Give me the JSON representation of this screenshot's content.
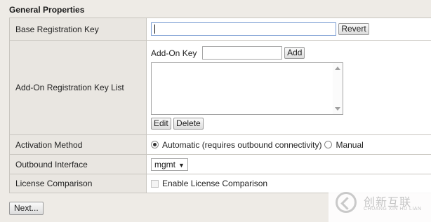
{
  "section": {
    "title": "General Properties"
  },
  "rows": {
    "base_key": {
      "label": "Base Registration Key",
      "value": "",
      "revert_label": "Revert"
    },
    "addon": {
      "label": "Add-On Registration Key List",
      "addon_key_label": "Add-On Key",
      "addon_key_value": "",
      "add_label": "Add",
      "edit_label": "Edit",
      "delete_label": "Delete"
    },
    "activation": {
      "label": "Activation Method",
      "automatic_label": "Automatic (requires outbound connectivity)",
      "manual_label": "Manual",
      "selected": "automatic"
    },
    "outbound": {
      "label": "Outbound Interface",
      "selected": "mgmt"
    },
    "license": {
      "label": "License Comparison",
      "checkbox_label": "Enable License Comparison",
      "checked": false,
      "disabled": true
    }
  },
  "footer": {
    "next_label": "Next..."
  },
  "watermark": {
    "cn_text": "创新互联",
    "en_text": "CHUANG XIN HU LIAN"
  },
  "icons": {
    "dropdown": "chevron-down-icon",
    "scroll_up": "scroll-up-icon",
    "scroll_down": "scroll-down-icon",
    "watermark_logo": "logo-icon"
  }
}
